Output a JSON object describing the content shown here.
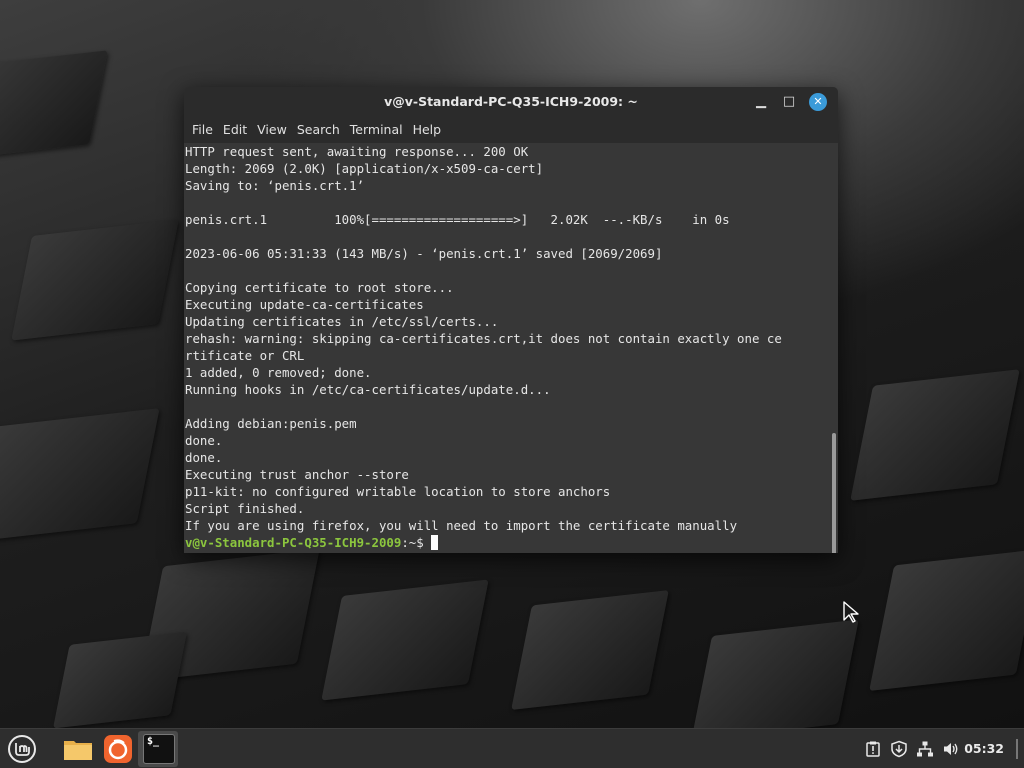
{
  "window": {
    "title": "v@v-Standard-PC-Q35-ICH9-2009: ~",
    "menu": [
      "File",
      "Edit",
      "View",
      "Search",
      "Terminal",
      "Help"
    ]
  },
  "terminal": {
    "lines": [
      "HTTP request sent, awaiting response... 200 OK",
      "Length: 2069 (2.0K) [application/x-x509-ca-cert]",
      "Saving to: ‘penis.crt.1’",
      "",
      "penis.crt.1         100%[===================>]   2.02K  --.-KB/s    in 0s",
      "",
      "2023-06-06 05:31:33 (143 MB/s) - ‘penis.crt.1’ saved [2069/2069]",
      "",
      "Copying certificate to root store...",
      "Executing update-ca-certificates",
      "Updating certificates in /etc/ssl/certs...",
      "rehash: warning: skipping ca-certificates.crt,it does not contain exactly one ce",
      "rtificate or CRL",
      "1 added, 0 removed; done.",
      "Running hooks in /etc/ca-certificates/update.d...",
      "",
      "Adding debian:penis.pem",
      "done.",
      "done.",
      "Executing trust anchor --store",
      "p11-kit: no configured writable location to store anchors",
      "Script finished.",
      "If you are using firefox, you will need to import the certificate manually"
    ],
    "prompt_user": "v@v-Standard-PC-Q35-ICH9-2009",
    "prompt_path": ":~$"
  },
  "taskbar": {
    "clock": "05:32",
    "terminal_label": "$_"
  },
  "colors": {
    "prompt": "#8cc63e",
    "close_button": "#3b9bd9",
    "terminal_bg": "#373737"
  }
}
